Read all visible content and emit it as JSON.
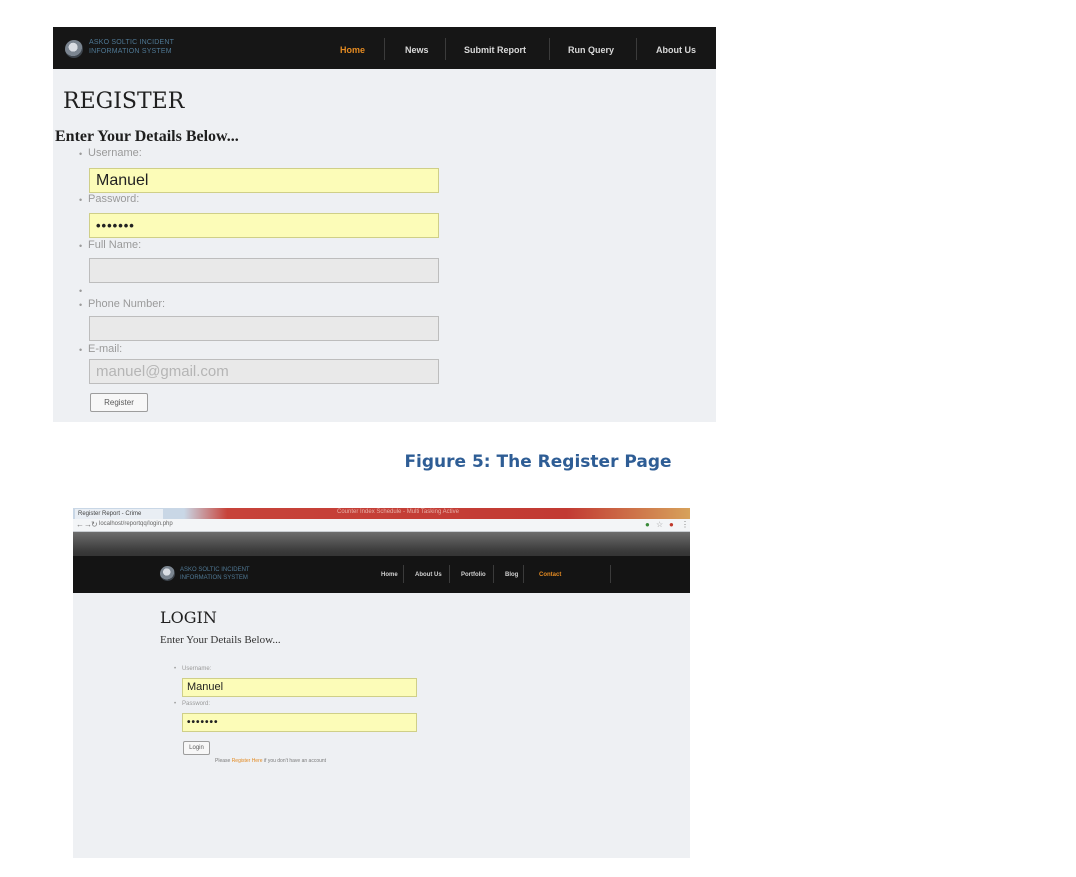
{
  "register": {
    "brand_line1": "ASKO SOLTIC INCIDENT",
    "brand_line2": "INFORMATION SYSTEM",
    "nav": [
      "Home",
      "News",
      "Submit Report",
      "Run Query",
      "About Us"
    ],
    "nav_active": 0,
    "title": "REGISTER",
    "subtitle": "Enter Your Details Below...",
    "fields": {
      "username_label": "Username:",
      "username_value": "Manuel",
      "password_label": "Password:",
      "password_value": "•••••••",
      "fullname_label": "Full Name:",
      "fullname_value": "",
      "phone_label": "Phone Number:",
      "phone_value": "",
      "email_label": "E-mail:",
      "email_value": "manuel@gmail.com"
    },
    "register_button": "Register"
  },
  "caption": "Figure 5: The Register Page",
  "login": {
    "browser": {
      "tab_title": "Register Report - Crime",
      "window_title": "Counter Index Schedule - Multi Tasking Active",
      "url": "localhost/reportqq/login.php"
    },
    "brand_line1": "ASKO SOLTIC INCIDENT",
    "brand_line2": "INFORMATION SYSTEM",
    "nav": [
      "Home",
      "About Us",
      "Portfolio",
      "Blog",
      "Contact"
    ],
    "nav_active": 4,
    "title": "LOGIN",
    "subtitle": "Enter Your Details Below...",
    "fields": {
      "username_label": "Username:",
      "username_value": "Manuel",
      "password_label": "Password:",
      "password_value": "•••••••"
    },
    "login_button": "Login",
    "note_prefix": "Please ",
    "note_link": "Register Here",
    "note_suffix": " if you don't have an account"
  }
}
